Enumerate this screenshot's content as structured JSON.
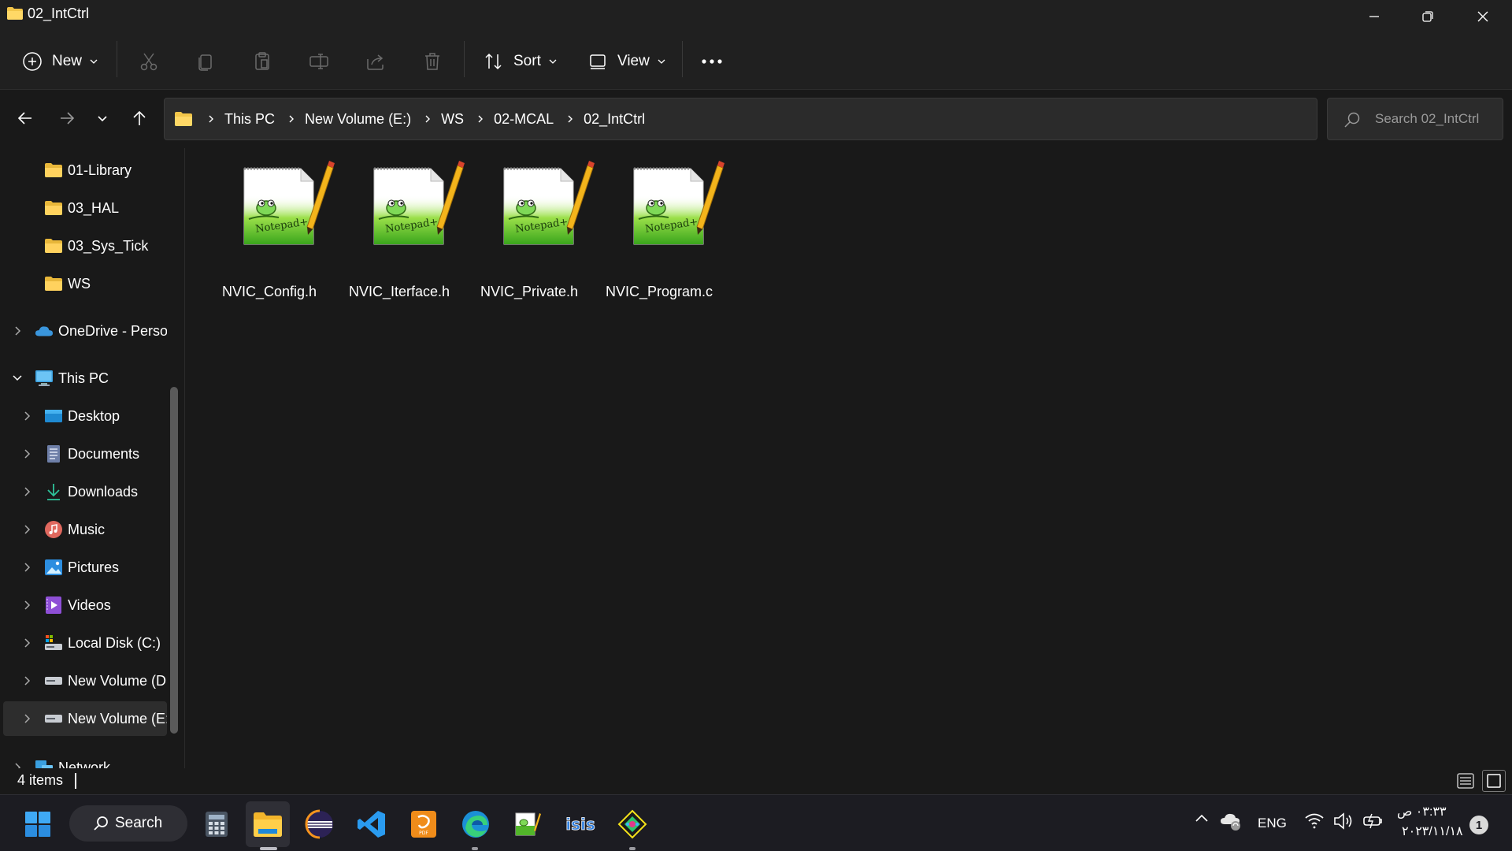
{
  "window": {
    "title": "02_IntCtrl",
    "icon": "folder-icon"
  },
  "commandbar": {
    "new_label": "New",
    "sort_label": "Sort",
    "view_label": "View",
    "icons": [
      "cut-icon",
      "copy-icon",
      "paste-icon",
      "rename-icon",
      "share-icon",
      "delete-icon",
      "more-icon"
    ]
  },
  "address": {
    "crumbs": [
      "This PC",
      "New Volume (E:)",
      "WS",
      "02-MCAL",
      "02_IntCtrl"
    ],
    "search_placeholder": "Search 02_IntCtrl"
  },
  "sidebar": {
    "items": [
      {
        "label": "01-Library",
        "icon": "folder-icon"
      },
      {
        "label": "03_HAL",
        "icon": "folder-icon"
      },
      {
        "label": "03_Sys_Tick",
        "icon": "folder-icon"
      },
      {
        "label": "WS",
        "icon": "folder-icon"
      },
      {
        "label": "OneDrive - Perso",
        "icon": "onedrive-icon"
      },
      {
        "label": "This PC",
        "icon": "this-pc-icon"
      },
      {
        "label": "Desktop",
        "icon": "desktop-icon"
      },
      {
        "label": "Documents",
        "icon": "documents-icon"
      },
      {
        "label": "Downloads",
        "icon": "downloads-icon"
      },
      {
        "label": "Music",
        "icon": "music-icon"
      },
      {
        "label": "Pictures",
        "icon": "pictures-icon"
      },
      {
        "label": "Videos",
        "icon": "videos-icon"
      },
      {
        "label": "Local Disk (C:)",
        "icon": "local-disk-icon"
      },
      {
        "label": "New Volume (D",
        "icon": "drive-icon"
      },
      {
        "label": "New Volume (E:",
        "icon": "drive-icon"
      },
      {
        "label": "Network",
        "icon": "network-icon"
      }
    ]
  },
  "files": [
    {
      "name": "NVIC_Config.h",
      "icon": "notepad-plus-plus-icon"
    },
    {
      "name": "NVIC_Iterface.h",
      "icon": "notepad-plus-plus-icon"
    },
    {
      "name": "NVIC_Private.h",
      "icon": "notepad-plus-plus-icon"
    },
    {
      "name": "NVIC_Program.c",
      "icon": "notepad-plus-plus-icon"
    }
  ],
  "status": {
    "item_count": "4 items"
  },
  "taskbar": {
    "search_label": "Search",
    "apps": [
      "start-icon",
      "calculator-icon",
      "file-explorer-icon",
      "eclipse-icon",
      "vscode-icon",
      "pdf-icon",
      "edge-icon",
      "notepad-plus-plus-icon",
      "isis-icon",
      "game-icon"
    ],
    "tray": {
      "language": "ENG",
      "time": "٠٣:٣٣ ص",
      "date": "٢٠٢٣/١١/١٨",
      "notification_count": "1"
    }
  },
  "colors": {
    "background": "#191919",
    "chrome": "#202020",
    "folder": "#f3c64a",
    "accent": "#4cc2ff"
  }
}
